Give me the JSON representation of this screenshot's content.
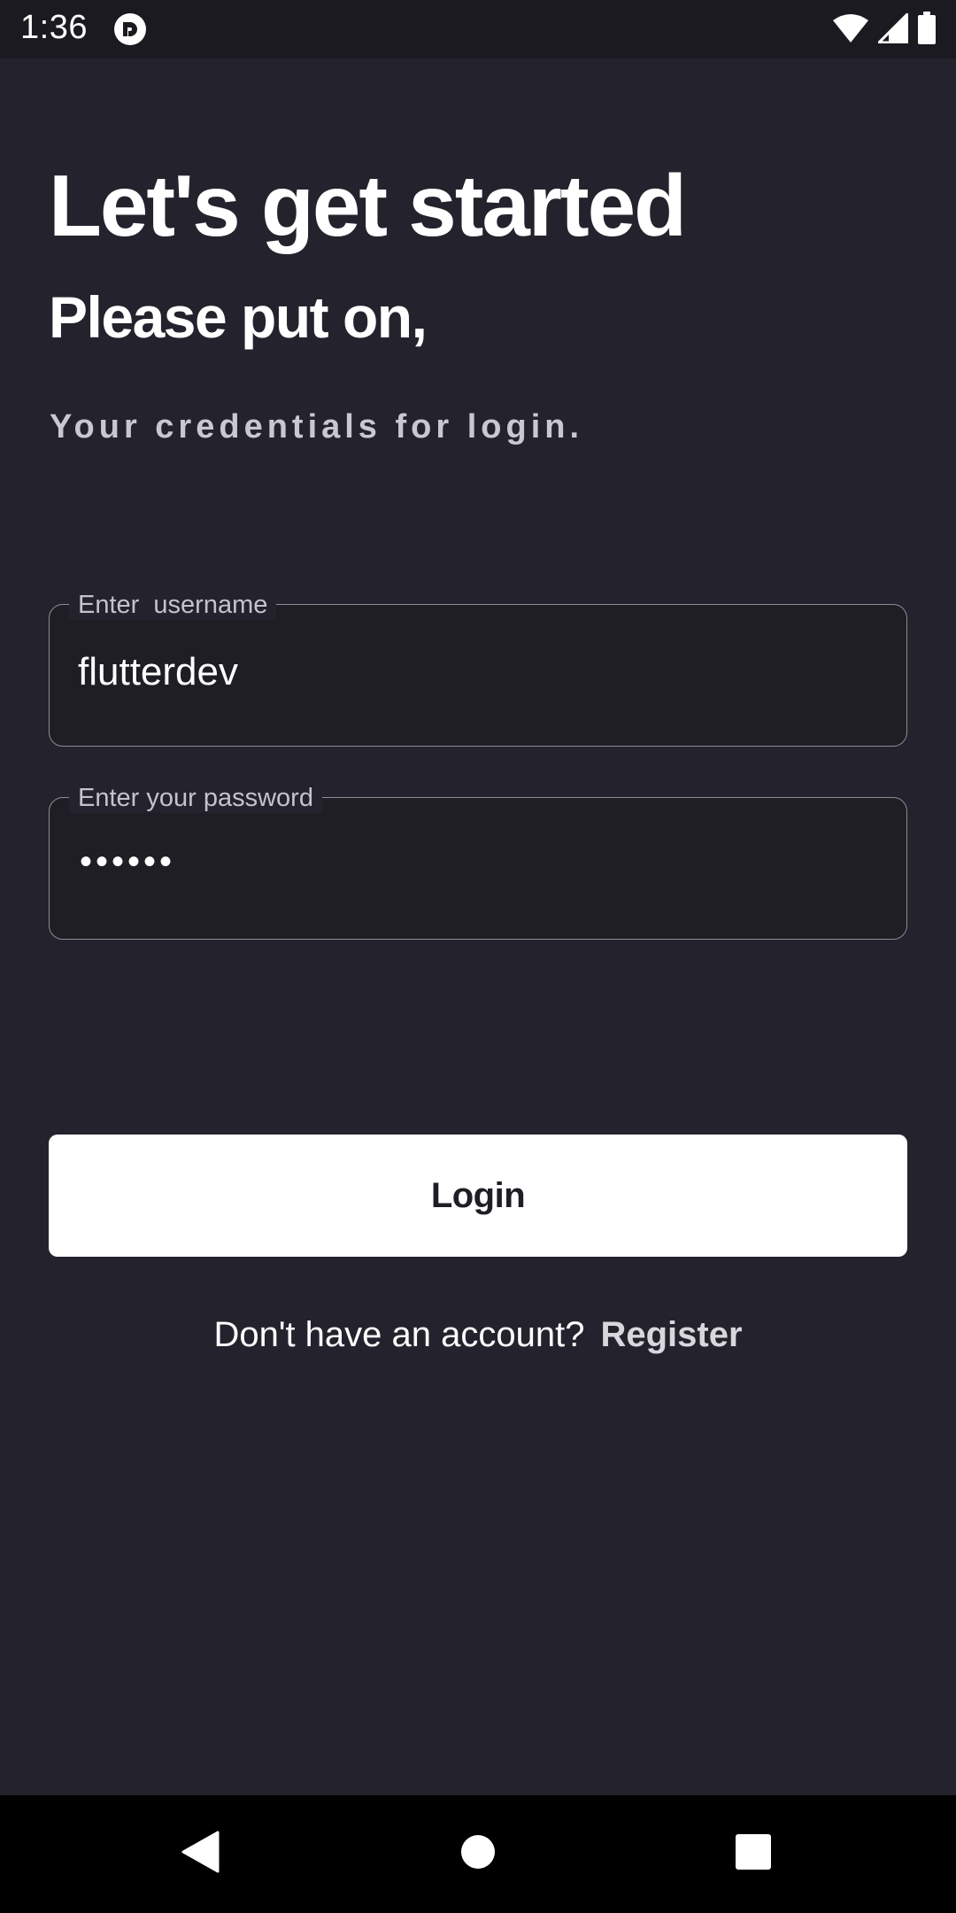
{
  "status_bar": {
    "time": "1:36",
    "icons": [
      "app-notification-icon",
      "wifi-icon",
      "cellular-signal-icon",
      "battery-icon"
    ]
  },
  "header": {
    "title": "Let's get started",
    "subtitle": "Please put on,",
    "caption": "Your credentials for login."
  },
  "form": {
    "username": {
      "label": "Enter  username",
      "value": "flutterdev"
    },
    "password": {
      "label": "Enter your password",
      "value": "••••••"
    },
    "login_label": "Login"
  },
  "register": {
    "prompt": "Don't have an account?",
    "link_label": "Register"
  },
  "nav_bar": {
    "icons": [
      "back-icon",
      "home-icon",
      "recents-icon"
    ]
  },
  "colors": {
    "background": "#24232d",
    "field_background": "#1f1e25",
    "button_background": "#ffffff",
    "text_primary": "#ffffff",
    "text_secondary": "#c9c8cf"
  }
}
